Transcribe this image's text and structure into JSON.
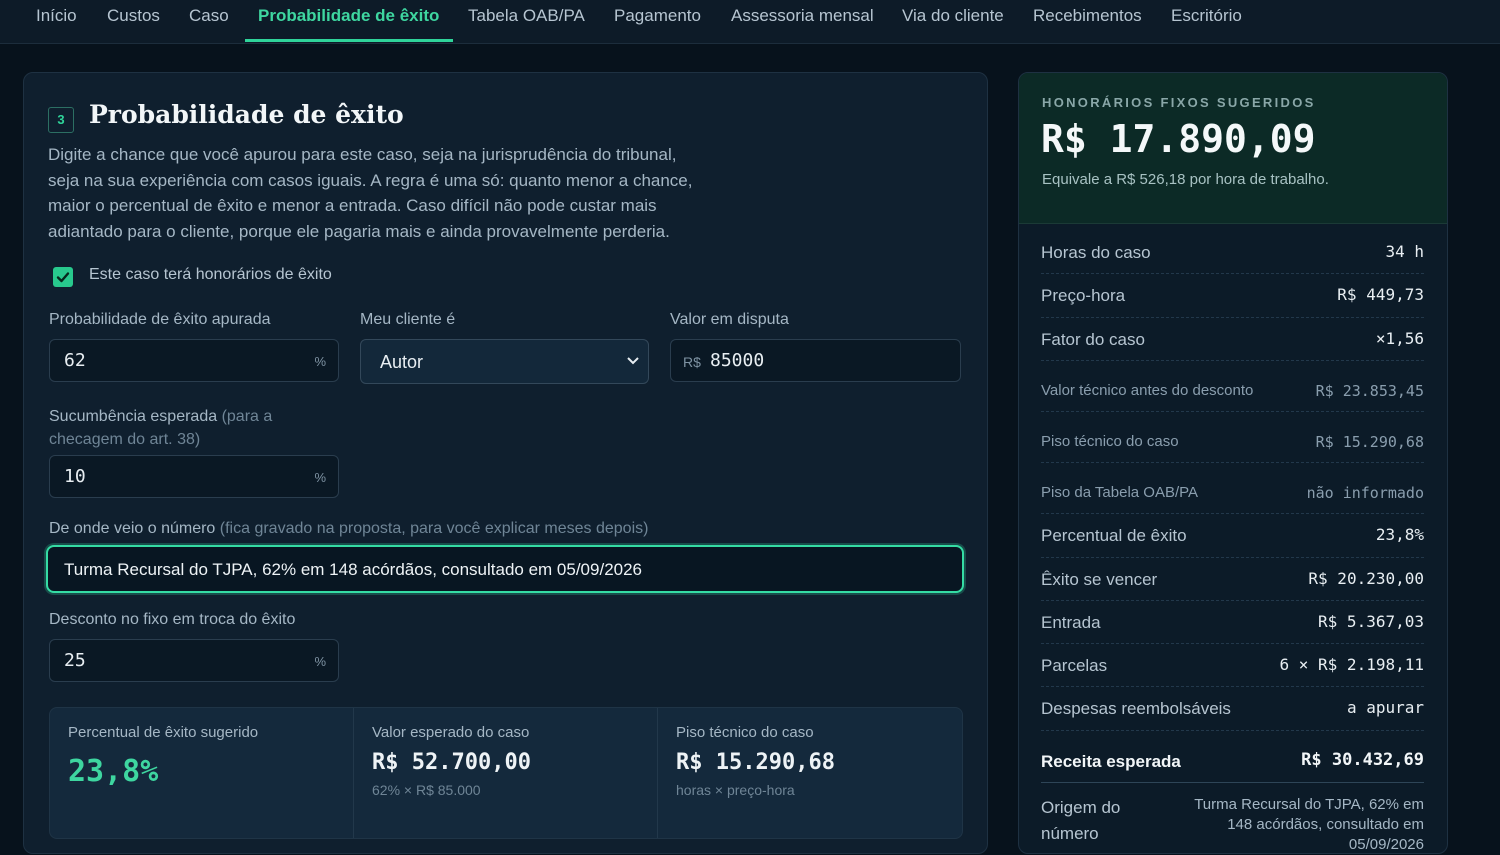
{
  "nav": {
    "tabs": [
      "Início",
      "Custos",
      "Caso",
      "Probabilidade de êxito",
      "Tabela OAB/PA",
      "Pagamento",
      "Assessoria mensal",
      "Via do cliente",
      "Recebimentos",
      "Escritório"
    ],
    "active": "Probabilidade de êxito"
  },
  "section": {
    "step": "3",
    "title": "Probabilidade de êxito",
    "intro": "Digite a chance que você apurou para este caso, seja na jurisprudência do tribunal, seja na sua experiência com casos iguais. A regra é uma só: quanto menor a chance, maior o percentual de êxito e menor a entrada. Caso difícil não pode custar mais adiantado para o cliente, porque ele pagaria mais e ainda provavelmente perderia."
  },
  "form": {
    "has_success_fee": {
      "label": "Este caso terá honorários de êxito",
      "checked": true
    },
    "probability": {
      "label": "Probabilidade de êxito apurada",
      "value": "62",
      "suffix": "%"
    },
    "client_role": {
      "label": "Meu cliente é",
      "value": "Autor"
    },
    "disputed_value": {
      "label": "Valor em disputa",
      "prefix": "R$",
      "value": "85000"
    },
    "expected_loss": {
      "label": "Sucumbência esperada",
      "hint_line1": "(para a",
      "hint_line2": "checagem do art. 38)",
      "value": "10",
      "suffix": "%"
    },
    "source": {
      "label": "De onde veio o número",
      "hint": "(fica gravado na proposta, para você explicar meses depois)",
      "value": "Turma Recursal do TJPA, 62% em 148 acórdãos, consultado em 05/09/2026"
    },
    "discount": {
      "label": "Desconto no fixo em troca do êxito",
      "value": "25",
      "suffix": "%"
    }
  },
  "stats": [
    {
      "label": "Percentual de êxito sugerido",
      "value": "23,8%",
      "sub": ""
    },
    {
      "label": "Valor esperado do caso",
      "value": "R$ 52.700,00",
      "sub": "62% × R$ 85.000"
    },
    {
      "label": "Piso técnico do caso",
      "value": "R$ 15.290,68",
      "sub": "horas × preço-hora"
    }
  ],
  "summary": {
    "kicker": "HONORÁRIOS FIXOS SUGERIDOS",
    "amount": "R$ 17.890,09",
    "note": "Equivale a R$ 526,18 por hora de trabalho.",
    "rows": [
      {
        "k": "Horas do caso",
        "v": "34 h"
      },
      {
        "k": "Preço-hora",
        "v": "R$ 449,73"
      },
      {
        "k": "Fator do caso",
        "v": "×1,56"
      },
      {
        "k": "Valor técnico antes do desconto",
        "v": "R$ 23.853,45"
      },
      {
        "k": "Piso técnico do caso",
        "v": "R$ 15.290,68"
      },
      {
        "k": "Piso da Tabela OAB/PA",
        "v": "não informado"
      },
      {
        "k": "Percentual de êxito",
        "v": "23,8%"
      },
      {
        "k": "Êxito se vencer",
        "v": "R$ 20.230,00"
      },
      {
        "k": "Entrada",
        "v": "R$ 5.367,03"
      },
      {
        "k": "Parcelas",
        "v": "6 × R$ 2.198,11"
      },
      {
        "k": "Despesas reembolsáveis",
        "v": "a apurar"
      },
      {
        "k": "Receita esperada",
        "v": "R$ 30.432,69"
      }
    ],
    "origin": {
      "k": "Origem do número",
      "v": "Turma Recursal do TJPA, 62% em 148 acórdãos, consultado em 05/09/2026"
    }
  },
  "colors": {
    "accent": "#2fd49a",
    "background": "#07121c",
    "card": "#0f1f2e"
  }
}
